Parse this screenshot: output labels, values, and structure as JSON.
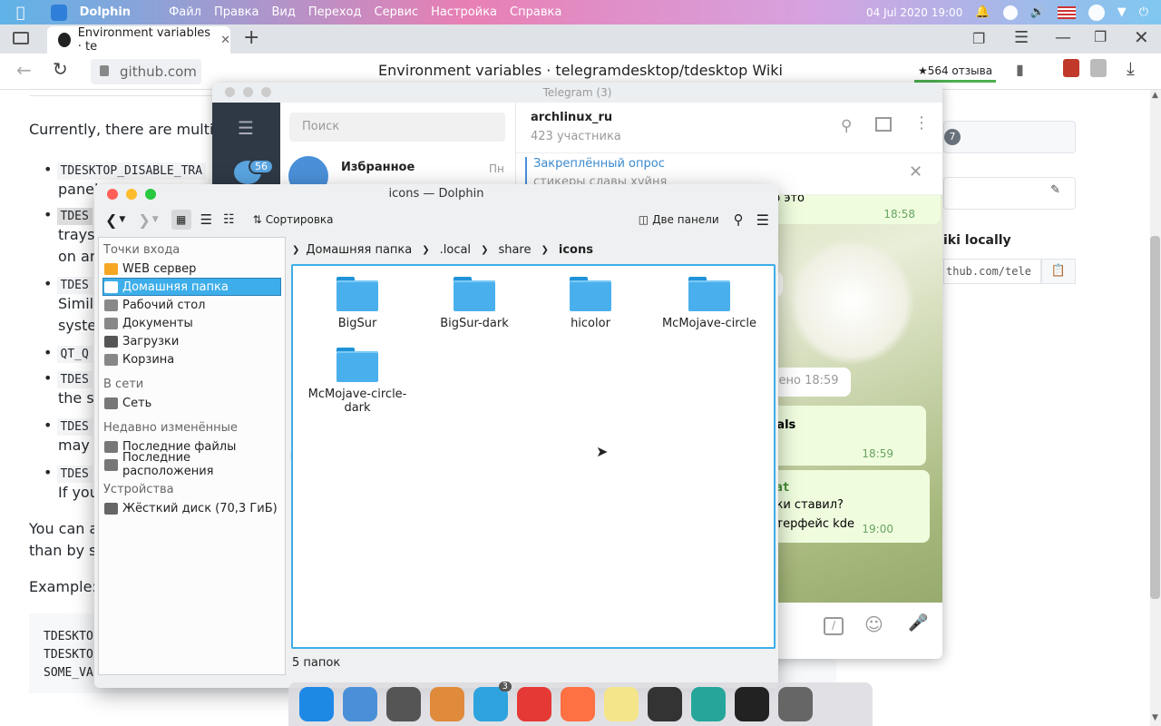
{
  "menubar": {
    "app": "Dolphin",
    "items": [
      "Файл",
      "Правка",
      "Вид",
      "Переход",
      "Сервис",
      "Настройка",
      "Справка"
    ],
    "datetime": "04 Jul 2020 19:00"
  },
  "browser": {
    "tab_title": "Environment variables · te",
    "url": "github.com",
    "page_title": "Environment variables · telegramdesktop/tdesktop Wiki",
    "reviews": "★564 отзыва"
  },
  "github": {
    "p1": "Currently, there are multiple",
    "li1_code": "TDESKTOP_DISABLE_TRA",
    "li1_text": "panel",
    "li2_code": "TDES",
    "li2_text1": "trays,",
    "li2_text2": "on an",
    "li3_code": "TDES",
    "li3_text1": "Simila",
    "li3_text2": "system",
    "li4_code": "QT_Q",
    "li5_code": "TDES",
    "li5_text": "the sy",
    "li6_code": "TDES",
    "li6_text": "may c",
    "li7_code": "TDES",
    "li7_text": "If you",
    "p2a": "You can a",
    "p2b": "than by sh",
    "example": "Example:",
    "code_lines": [
      "TDESKTO",
      "TDESKTO",
      "SOME_VA"
    ],
    "side_badge": "7",
    "side_heading": "iki locally",
    "side_url": "thub.com/tele"
  },
  "telegram": {
    "title": "Telegram (3)",
    "badge": "56",
    "search_placeholder": "Поиск",
    "chat1_name": "Избранное",
    "chat1_time": "Пн",
    "chat_name": "archlinux_ru",
    "members": "423 участника",
    "pin_title": "Закреплённый опрос",
    "pin_sub": "стикеры славы хуйня",
    "msg1": "что это",
    "msg1_time": "18:58",
    "msg2_time": "9",
    "msg3": "нено 18:59",
    "msg4": "bals",
    "msg4_time": "18:59",
    "msg5_name": "Hat",
    "msg5_line1": "нки ставил?",
    "msg5_line2": "нтерфейс kde",
    "msg5_time": "19:00"
  },
  "dolphin": {
    "title": "icons — Dolphin",
    "sort": "Сортировка",
    "dual": "Две панели",
    "sections": [
      {
        "header": "Точки входа",
        "items": [
          {
            "label": "WEB сервер",
            "color": "#f5a623"
          },
          {
            "label": "Домашняя папка",
            "color": "#3daee9",
            "selected": true
          },
          {
            "label": "Рабочий стол",
            "color": "#888"
          },
          {
            "label": "Документы",
            "color": "#888"
          },
          {
            "label": "Загрузки",
            "color": "#555"
          },
          {
            "label": "Корзина",
            "color": "#888"
          }
        ]
      },
      {
        "header": "В сети",
        "items": [
          {
            "label": "Сеть",
            "color": "#777"
          }
        ]
      },
      {
        "header": "Недавно изменённые",
        "items": [
          {
            "label": "Последние файлы",
            "color": "#777"
          },
          {
            "label": "Последние расположения",
            "color": "#777"
          }
        ]
      },
      {
        "header": "Устройства",
        "items": [
          {
            "label": "Жёсткий диск (70,3 ГиБ)",
            "color": "#666"
          }
        ]
      }
    ],
    "breadcrumb": [
      "Домашняя папка",
      ".local",
      "share",
      "icons"
    ],
    "folders": [
      "BigSur",
      "BigSur-dark",
      "hicolor",
      "McMojave-circle",
      "McMojave-circle-dark"
    ],
    "status": "5 папок"
  },
  "dock": {
    "badge": "3",
    "apps": [
      "appstore-icon",
      "finder-icon",
      "music-icon",
      "preview-icon",
      "telegram-icon",
      "yandex-icon",
      "firefox-icon",
      "notes-icon",
      "sublime-icon",
      "activity-icon",
      "terminal-icon",
      "settings-icon"
    ]
  }
}
